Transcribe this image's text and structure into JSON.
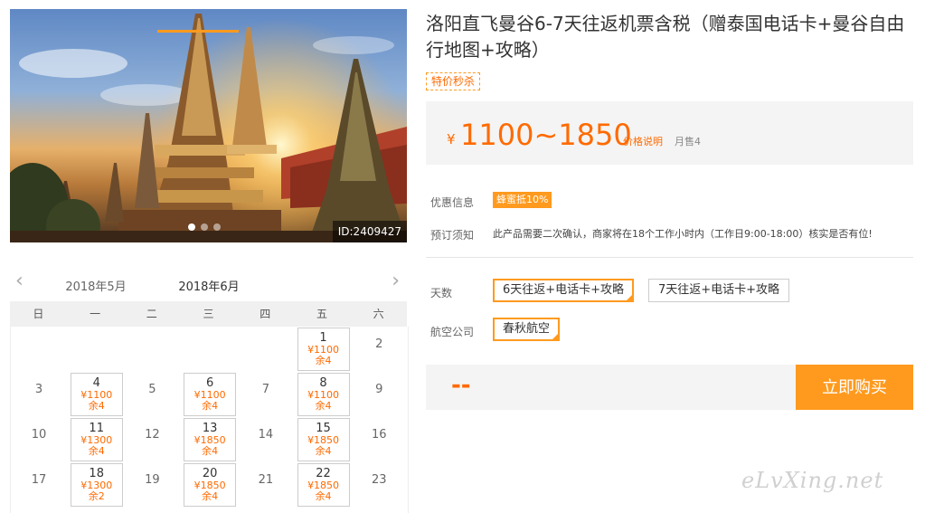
{
  "hero": {
    "id_label": "ID:2409427",
    "slides": 3,
    "active_slide": 1
  },
  "calendar": {
    "prev_month": "2018年5月",
    "current_month": "2018年6月",
    "weekdays": [
      "日",
      "一",
      "二",
      "三",
      "四",
      "五",
      "六"
    ],
    "cells": [
      {
        "day": "1",
        "price": "¥1100",
        "remain": "余4",
        "col": 5,
        "row": 0
      },
      {
        "day": "2",
        "col": 6,
        "row": 0
      },
      {
        "day": "3",
        "col": 0,
        "row": 1
      },
      {
        "day": "4",
        "price": "¥1100",
        "remain": "余4",
        "col": 1,
        "row": 1
      },
      {
        "day": "5",
        "col": 2,
        "row": 1
      },
      {
        "day": "6",
        "price": "¥1100",
        "remain": "余4",
        "col": 3,
        "row": 1
      },
      {
        "day": "7",
        "col": 4,
        "row": 1
      },
      {
        "day": "8",
        "price": "¥1100",
        "remain": "余4",
        "col": 5,
        "row": 1
      },
      {
        "day": "9",
        "col": 6,
        "row": 1
      },
      {
        "day": "10",
        "col": 0,
        "row": 2
      },
      {
        "day": "11",
        "price": "¥1300",
        "remain": "余4",
        "col": 1,
        "row": 2
      },
      {
        "day": "12",
        "col": 2,
        "row": 2
      },
      {
        "day": "13",
        "price": "¥1850",
        "remain": "余4",
        "col": 3,
        "row": 2
      },
      {
        "day": "14",
        "col": 4,
        "row": 2
      },
      {
        "day": "15",
        "price": "¥1850",
        "remain": "余4",
        "col": 5,
        "row": 2
      },
      {
        "day": "16",
        "col": 6,
        "row": 2
      },
      {
        "day": "17",
        "col": 0,
        "row": 3
      },
      {
        "day": "18",
        "price": "¥1300",
        "remain": "余2",
        "col": 1,
        "row": 3
      },
      {
        "day": "19",
        "col": 2,
        "row": 3
      },
      {
        "day": "20",
        "price": "¥1850",
        "remain": "余4",
        "col": 3,
        "row": 3
      },
      {
        "day": "21",
        "col": 4,
        "row": 3
      },
      {
        "day": "22",
        "price": "¥1850",
        "remain": "余4",
        "col": 5,
        "row": 3
      },
      {
        "day": "23",
        "col": 6,
        "row": 3
      }
    ]
  },
  "product": {
    "title": "洛阳直飞曼谷6-7天往返机票含税（赠泰国电话卡+曼谷自由行地图+攻略）",
    "badge": "特价秒杀",
    "currency": "¥",
    "price_range": "1100~1850",
    "price_note": "价格说明",
    "monthly_sales": "月售4",
    "promo_label": "优惠信息",
    "promo_tag": "蜂蜜抵10%",
    "notice_label": "预订须知",
    "notice_text": "此产品需要二次确认，商家将在18个工作小时内（工作日9:00-18:00）核实是否有位!",
    "days_label": "天数",
    "day_options": [
      "6天往返+电话卡+攻略",
      "7天往返+电话卡+攻略"
    ],
    "airline_label": "航空公司",
    "airline_options": [
      "春秋航空"
    ],
    "total_placeholder": "--",
    "buy_label": "立即购买"
  },
  "watermark": "eLvXing.net",
  "colors": {
    "accent": "#ff9a1e",
    "price": "#ff6a00"
  }
}
